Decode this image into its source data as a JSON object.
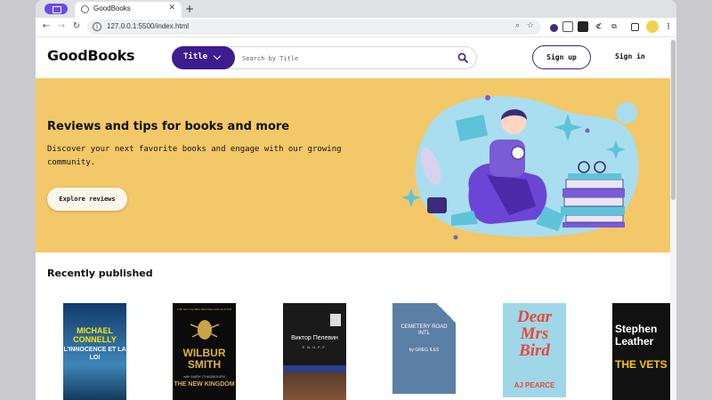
{
  "browser": {
    "tab_title": "GoodBooks",
    "url": "127.0.0.1:5500/index.html"
  },
  "site": {
    "logo": "GoodBooks",
    "search": {
      "select_label": "Title",
      "placeholder": "Search by Title"
    },
    "signup_label": "Sign up",
    "signin_label": "Sign in"
  },
  "hero": {
    "title": "Reviews and tips for books and more",
    "text": "Discover your next favorite books and engage with our growing community.",
    "button_label": "Explore reviews"
  },
  "recent": {
    "title": "Recently published",
    "books": [
      {
        "author": "MICHAEL CONNELLY",
        "title": "L'INNOCENCE ET LA LOI"
      },
      {
        "author": "WILBUR SMITH",
        "title": "THE NEW KINGDOM",
        "tagline": "THE NO.1 GLOBAL BESTSELLING AUTHOR",
        "coauthor": "with MARK CHADBOURN"
      },
      {
        "author": "Виктор Пелевин",
        "title": "S.N.U.F.F."
      },
      {
        "author": "by GREG ILES",
        "title": "CEMETERY ROAD INTL"
      },
      {
        "author": "AJ PEARCE",
        "title": "Dear Mrs Bird"
      },
      {
        "author": "Stephen Leather",
        "title": "THE VETS"
      }
    ]
  },
  "colors": {
    "accent": "#3d1c8f",
    "hero_bg": "#f2c869",
    "profile": "#6b4ce6"
  },
  "icons": [
    "browser-profile-icon",
    "favicon-icon",
    "close-icon",
    "new-tab-icon",
    "back-icon",
    "forward-icon",
    "reload-icon",
    "site-info-icon",
    "zoom-icon",
    "bookmark-star-icon",
    "extension-icon",
    "puzzle-icon",
    "sidebar-icon",
    "avatar-icon",
    "menu-icon",
    "chevron-down-icon",
    "search-icon"
  ]
}
